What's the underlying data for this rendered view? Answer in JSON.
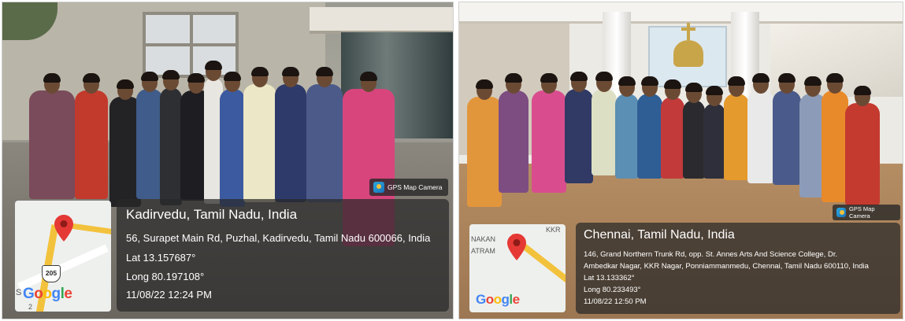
{
  "left_photo": {
    "badge": "GPS Map Camera",
    "title": "Kadirvedu, Tamil Nadu, India",
    "address": "56, Surapet Main Rd, Puzhal, Kadirvedu, Tamil Nadu 600066, India",
    "lat": "Lat 13.157687°",
    "long": "Long 80.197108°",
    "datetime": "11/08/22 12:24 PM",
    "map": {
      "route_shield": "205",
      "label_left": "S",
      "label_bottom": "2",
      "logo": [
        "G",
        "o",
        "o",
        "g",
        "l",
        "e"
      ]
    }
  },
  "right_photo": {
    "badge": "GPS Map Camera",
    "title": "Chennai, Tamil Nadu, India",
    "address_line1": "146, Grand Northern Trunk Rd, opp. St. Annes Arts And Science College, Dr.",
    "address_line2": "Ambedkar Nagar, KKR Nagar, Ponniammanmedu, Chennai, Tamil Nadu 600110, India",
    "lat": "Lat 13.133362°",
    "long": "Long 80.233493°",
    "datetime": "11/08/22 12:50 PM",
    "map": {
      "label_top_left": "NAKAN",
      "label_mid_left": "ATRAM",
      "label_top_right": "KKR",
      "logo": [
        "G",
        "o",
        "o",
        "g",
        "l",
        "e"
      ]
    }
  },
  "colors": {
    "google_blue": "#4285F4",
    "google_red": "#EA4335",
    "google_yellow": "#FBBC05",
    "google_green": "#34A853",
    "pin_red": "#E53935",
    "overlay": "rgba(40,40,40,0.72)"
  }
}
